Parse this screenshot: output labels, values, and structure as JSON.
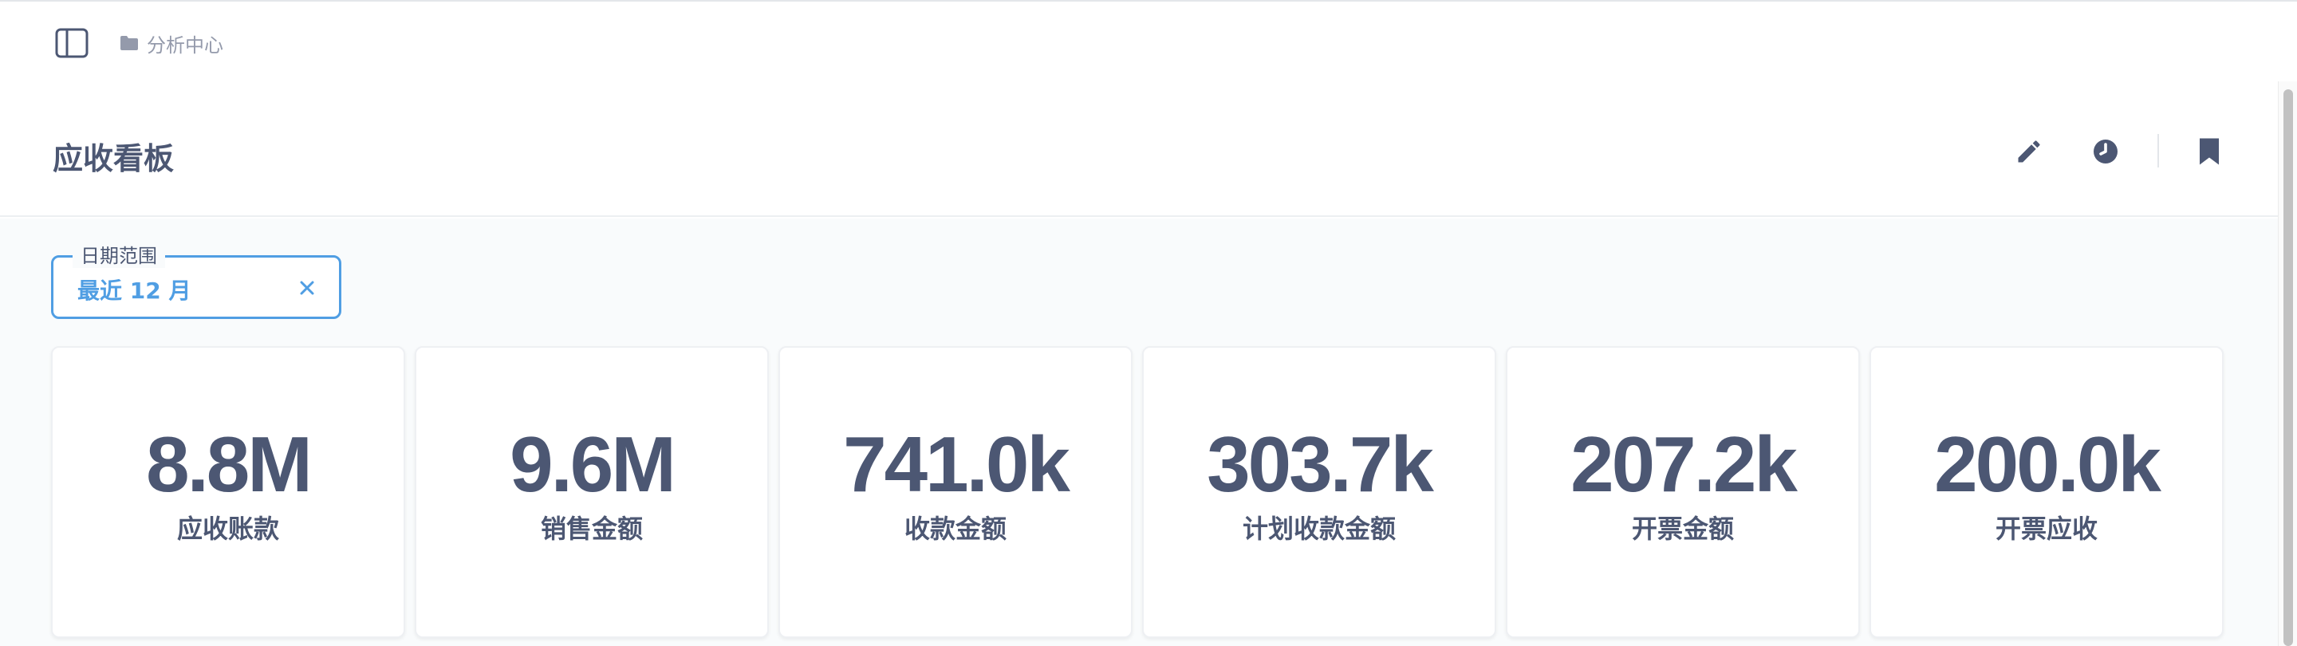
{
  "breadcrumb": {
    "collection": "分析中心"
  },
  "header": {
    "title": "应收看板"
  },
  "filter": {
    "label": "日期范围",
    "value": "最近 12 月"
  },
  "cards": [
    {
      "value": "8.8M",
      "label": "应收账款"
    },
    {
      "value": "9.6M",
      "label": "销售金额"
    },
    {
      "value": "741.0k",
      "label": "收款金额"
    },
    {
      "value": "303.7k",
      "label": "计划收款金额"
    },
    {
      "value": "207.2k",
      "label": "开票金额"
    },
    {
      "value": "200.0k",
      "label": "开票应收"
    }
  ],
  "icons": {
    "sidebar_toggle": "sidebar-toggle-icon",
    "folder": "folder-icon",
    "edit": "pencil-icon",
    "history": "clock-icon",
    "bookmark": "bookmark-icon",
    "clear": "close-icon"
  },
  "colors": {
    "accent": "#509ee3",
    "text": "#4c5773",
    "muted": "#949aab",
    "background": "#f9fbfc"
  }
}
